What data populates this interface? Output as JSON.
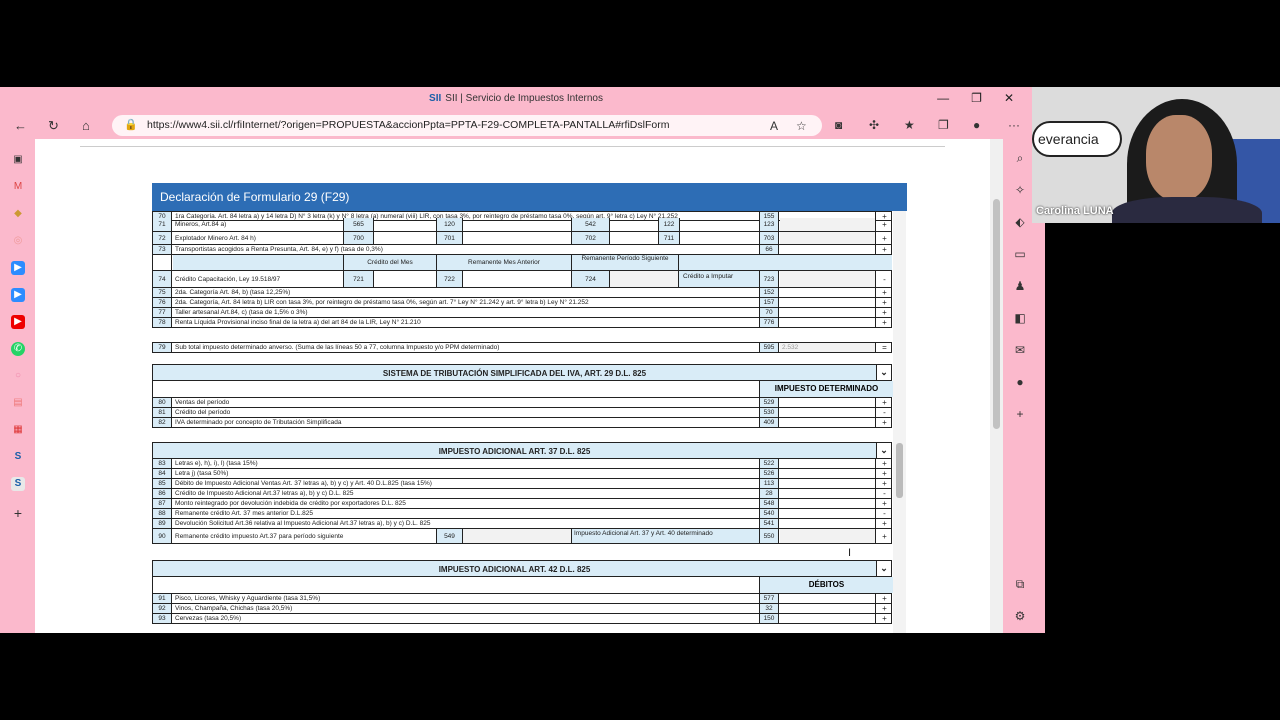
{
  "browser": {
    "tab_title": "SII | Servicio de Impuestos Internos",
    "logo_text": "SII",
    "url": "https://www4.sii.cl/rfiInternet/?origen=PROPUESTA&accionPpta=PPTA-F29-COMPLETA-PANTALLA#rfiDslForm",
    "win_minimize": "—",
    "win_restore": "❐",
    "win_close": "✕",
    "back": "←",
    "reload": "↻",
    "home": "⌂",
    "more": "···"
  },
  "form": {
    "title": "Declaración de Formulario 29 (F29)"
  },
  "rows_top": [
    {
      "num": "70",
      "desc": "1ra Categoría. Art. 84 letra a) y 14 letra D) N° 3 letra (k) y N° 8 letra (a) numeral (viii) LIR, con tasa 3%, por reintegro de préstamo tasa 0%, según art. 9° letra c) Ley N° 21.252",
      "code": "155",
      "sign": "+"
    },
    {
      "num": "72",
      "desc": "Explotador Minero Art. 84 h)",
      "code": "703",
      "sign": "+"
    },
    {
      "num": "73",
      "desc": "Transportistas acogidos a Renta Presunta, Art. 84, e) y f) (tasa de 0,3%)",
      "code": "66",
      "sign": "+"
    }
  ],
  "row71": {
    "num": "71",
    "desc": "Mineros, Art.84 a)",
    "c1": "565",
    "c2": "120",
    "c3": "542",
    "c4": "122",
    "code": "123",
    "sign": "+"
  },
  "row72_cells": {
    "c1": "700",
    "c2": "701",
    "c3": "702",
    "c4": "711"
  },
  "credit_head": {
    "c1": "Crédito del Mes",
    "c2": "Remanente Mes Anterior",
    "c3": "Remanente Período Siguiente"
  },
  "row74": {
    "num": "74",
    "desc": "Crédito Capacitación, Ley 19.518/97",
    "c1": "721",
    "c2": "722",
    "c3": "724",
    "label": "Crédito a Imputar",
    "code": "723",
    "sign": "-"
  },
  "rows_mid": [
    {
      "num": "75",
      "desc": "2da. Categoría Art. 84, b) (tasa 12,25%)",
      "code": "152",
      "sign": "+"
    },
    {
      "num": "76",
      "desc": "2da. Categoría, Art. 84 letra b) LIR con tasa 3%, por reintegro de préstamo tasa 0%, según art. 7° Ley N° 21.242 y art. 9° letra b) Ley N° 21.252",
      "code": "157",
      "sign": "+"
    },
    {
      "num": "77",
      "desc": "Taller artesanal Art.84, c) (tasa de 1,5% o 3%)",
      "code": "70",
      "sign": "+"
    },
    {
      "num": "78",
      "desc": "Renta Líquida Provisional inciso final de la letra a) del art 84 de la LIR, Ley N° 21.210",
      "code": "776",
      "sign": "+"
    }
  ],
  "row79": {
    "num": "79",
    "desc": "Sub total impuesto determinado anverso. (Suma de las líneas 50 a 77, columna Impuesto y/o PPM determinado)",
    "code": "595",
    "value": "2.532",
    "sign": "="
  },
  "section_iva": {
    "title": "SISTEMA DE TRIBUTACIÓN SIMPLIFICADA DEL IVA, ART. 29 D.L. 825",
    "col_title": "IMPUESTO DETERMINADO",
    "chevron": "⌄",
    "rows": [
      {
        "num": "80",
        "desc": "Ventas del período",
        "code": "529",
        "sign": "+"
      },
      {
        "num": "81",
        "desc": "Crédito del período",
        "code": "530",
        "sign": "-"
      },
      {
        "num": "82",
        "desc": "IVA determinado por concepto de Tributación Simplificada",
        "code": "409",
        "sign": "+"
      }
    ]
  },
  "section_37": {
    "title": "IMPUESTO ADICIONAL ART. 37 D.L. 825",
    "chevron": "⌄",
    "rows": [
      {
        "num": "83",
        "desc": "Letras e), h), i), l) (tasa 15%)",
        "code": "522",
        "sign": "+"
      },
      {
        "num": "84",
        "desc": "Letra j) (tasa 50%)",
        "code": "526",
        "sign": "+"
      },
      {
        "num": "85",
        "desc": "Débito de Impuesto Adicional Ventas Art. 37 letras a), b) y c) y Art. 40 D.L.825 (tasa 15%)",
        "code": "113",
        "sign": "+"
      },
      {
        "num": "86",
        "desc": "Crédito de Impuesto Adicional Art.37 letras a), b) y c) D.L. 825",
        "code": "28",
        "sign": "-"
      },
      {
        "num": "87",
        "desc": "Monto reintegrado por devolución indebida de crédito por exportadores D.L. 825",
        "code": "548",
        "sign": "+"
      },
      {
        "num": "88",
        "desc": "Remanente crédito Art. 37 mes anterior D.L.825",
        "code": "540",
        "sign": "-"
      },
      {
        "num": "89",
        "desc": "Devolución Solicitud Art.36 relativa al Impuesto Adicional Art.37 letras a), b) y c) D.L. 825",
        "code": "541",
        "sign": "+"
      }
    ],
    "row90": {
      "num": "90",
      "desc": "Remanente crédito impuesto Art.37 para período siguiente",
      "c1": "549",
      "label": "Impuesto Adicional Art. 37 y Art. 40 determinado",
      "code": "550",
      "sign": "+"
    }
  },
  "section_42": {
    "title": "IMPUESTO ADICIONAL ART. 42 D.L. 825",
    "col_title": "DÉBITOS",
    "chevron": "⌄",
    "rows": [
      {
        "num": "91",
        "desc": "Pisco, Licores, Whisky y Aguardiente (tasa 31,5%)",
        "code": "577",
        "sign": "+"
      },
      {
        "num": "92",
        "desc": "Vinos, Champaña, Chichas (tasa 20,5%)",
        "code": "32",
        "sign": "+"
      },
      {
        "num": "93",
        "desc": "Cervezas (tasa 20,5%)",
        "code": "150",
        "sign": "+"
      }
    ]
  },
  "webcam": {
    "name": "Carolina LUNA",
    "cloud_text": "everancia"
  },
  "colors": {
    "accent": "#2d6db5",
    "browser_pink": "#fbb9cc",
    "cell_blue": "#d9ecf7"
  }
}
